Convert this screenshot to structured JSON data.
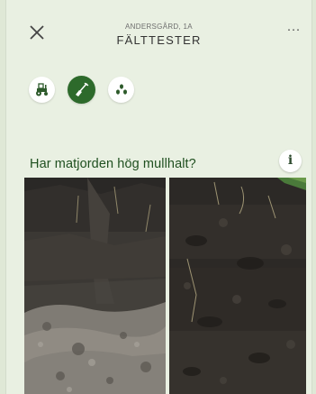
{
  "header": {
    "subtitle": "ANDERSGÅRD, 1A",
    "title": "FÄLTTESTER",
    "more_label": "···",
    "close_icon": "close-icon"
  },
  "test_icons": [
    {
      "name": "tractor-icon",
      "active": false
    },
    {
      "name": "shovel-icon",
      "active": true
    },
    {
      "name": "seeds-icon",
      "active": false
    }
  ],
  "question": {
    "text": "Har matjorden hög mullhalt?",
    "info_label": "i"
  },
  "photos": [
    {
      "name": "soil-photo-low-humus"
    },
    {
      "name": "soil-photo-high-humus"
    }
  ],
  "colors": {
    "background": "#e9f0e2",
    "accent": "#2d6a2b",
    "question_text": "#1f4f1f"
  }
}
